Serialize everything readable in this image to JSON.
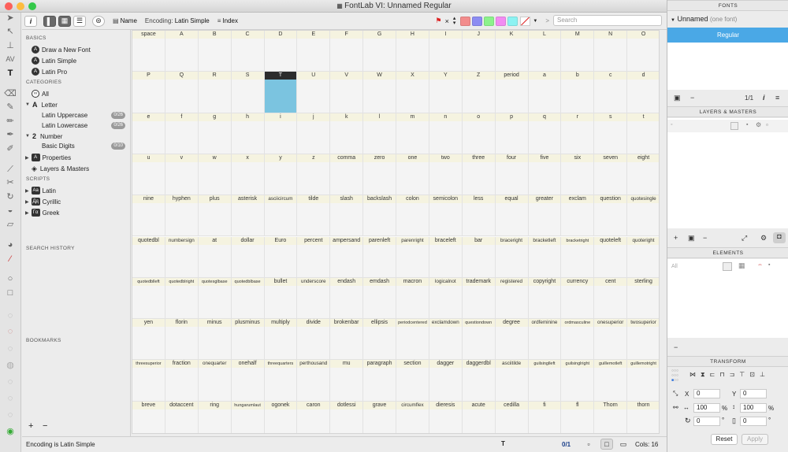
{
  "window": {
    "title": "FontLab VI: Unnamed Regular"
  },
  "toolbar": {
    "name_label": "Name",
    "encoding_label": "Encoding:",
    "encoding_value": "Latin Simple",
    "index_label": "Index",
    "close_mark": "×",
    "swatch_colors": [
      "#f28c8c",
      "#8c8cf2",
      "#8cf28c",
      "#f28cf2",
      "#8cf2f2"
    ],
    "search_placeholder": "Search"
  },
  "sidebar": {
    "basics_header": "BASICS",
    "basics": [
      "Draw a New Font",
      "Latin Simple",
      "Latin Pro"
    ],
    "categories_header": "CATEGORIES",
    "all_label": "All",
    "letter_label": "Letter",
    "latin_upper": "Latin Uppercase",
    "latin_upper_count": "0/26",
    "latin_lower": "Latin Lowercase",
    "latin_lower_count": "0/26",
    "number_label": "Number",
    "basic_digits": "Basic Digits",
    "basic_digits_count": "0/10",
    "properties_label": "Properties",
    "layers_label": "Layers & Masters",
    "scripts_header": "SCRIPTS",
    "scripts": [
      "Latin",
      "Cyrillic",
      "Greek"
    ],
    "search_history_header": "SEARCH HISTORY",
    "bookmarks_header": "BOOKMARKS",
    "add": "+",
    "remove": "−"
  },
  "glyphs": [
    "space",
    "A",
    "B",
    "C",
    "D",
    "E",
    "F",
    "G",
    "H",
    "I",
    "J",
    "K",
    "L",
    "M",
    "N",
    "O",
    "P",
    "Q",
    "R",
    "S",
    "T",
    "U",
    "V",
    "W",
    "X",
    "Y",
    "Z",
    "period",
    "a",
    "b",
    "c",
    "d",
    "e",
    "f",
    "g",
    "h",
    "i",
    "j",
    "k",
    "l",
    "m",
    "n",
    "o",
    "p",
    "q",
    "r",
    "s",
    "t",
    "u",
    "v",
    "w",
    "x",
    "y",
    "z",
    "comma",
    "zero",
    "one",
    "two",
    "three",
    "four",
    "five",
    "six",
    "seven",
    "eight",
    "nine",
    "hyphen",
    "plus",
    "asterisk",
    "asciicircum",
    "tilde",
    "slash",
    "backslash",
    "colon",
    "semicolon",
    "less",
    "equal",
    "greater",
    "exclam",
    "question",
    "quotesingle",
    "quotedbl",
    "numbersign",
    "at",
    "dollar",
    "Euro",
    "percent",
    "ampersand",
    "parenleft",
    "parenright",
    "braceleft",
    "bar",
    "braceright",
    "bracketleft",
    "bracketright",
    "quoteleft",
    "quoteright",
    "quotedblleft",
    "quotedblright",
    "quotesglbase",
    "quotedblbase",
    "bullet",
    "underscore",
    "endash",
    "emdash",
    "macron",
    "logicalnot",
    "trademark",
    "registered",
    "copyright",
    "currency",
    "cent",
    "sterling",
    "yen",
    "florin",
    "minus",
    "plusminus",
    "multiply",
    "divide",
    "brokenbar",
    "ellipsis",
    "periodcentered",
    "exclamdown",
    "questiondown",
    "degree",
    "ordfeminine",
    "ordmasculine",
    "onesuperior",
    "twosuperior",
    "threesuperior",
    "fraction",
    "onequarter",
    "onehalf",
    "threequarters",
    "perthousand",
    "mu",
    "paragraph",
    "section",
    "dagger",
    "daggerdbl",
    "asciitilde",
    "guilsinglleft",
    "guilsinglright",
    "guillemotleft",
    "guillemotright",
    "breve",
    "dotaccent",
    "ring",
    "hungarumlaut",
    "ogonek",
    "caron",
    "dotlessi",
    "grave",
    "circumflex",
    "dieresis",
    "acute",
    "cedilla",
    "fi",
    "fl",
    "Thorn",
    "thorn"
  ],
  "selected_glyph": "T",
  "status": {
    "message": "Encoding is Latin Simple",
    "current_glyph": "T",
    "count": "0/1",
    "cols_label": "Cols: 16"
  },
  "fonts_panel": {
    "header": "FONTS",
    "font_name": "Unnamed",
    "font_count": "(one font)",
    "style": "Regular",
    "page": "1/1"
  },
  "layers_panel": {
    "header": "LAYERS & MASTERS"
  },
  "elements_panel": {
    "header": "ELEMENTS",
    "filter": "All"
  },
  "transform_panel": {
    "header": "TRANSFORM",
    "x_label": "X",
    "x_value": "0",
    "y_label": "Y",
    "y_value": "0",
    "w_value": "100",
    "h_value": "100",
    "pct": "%",
    "rot_value": "0",
    "slant_value": "0",
    "deg": "°",
    "reset": "Reset",
    "apply": "Apply"
  }
}
